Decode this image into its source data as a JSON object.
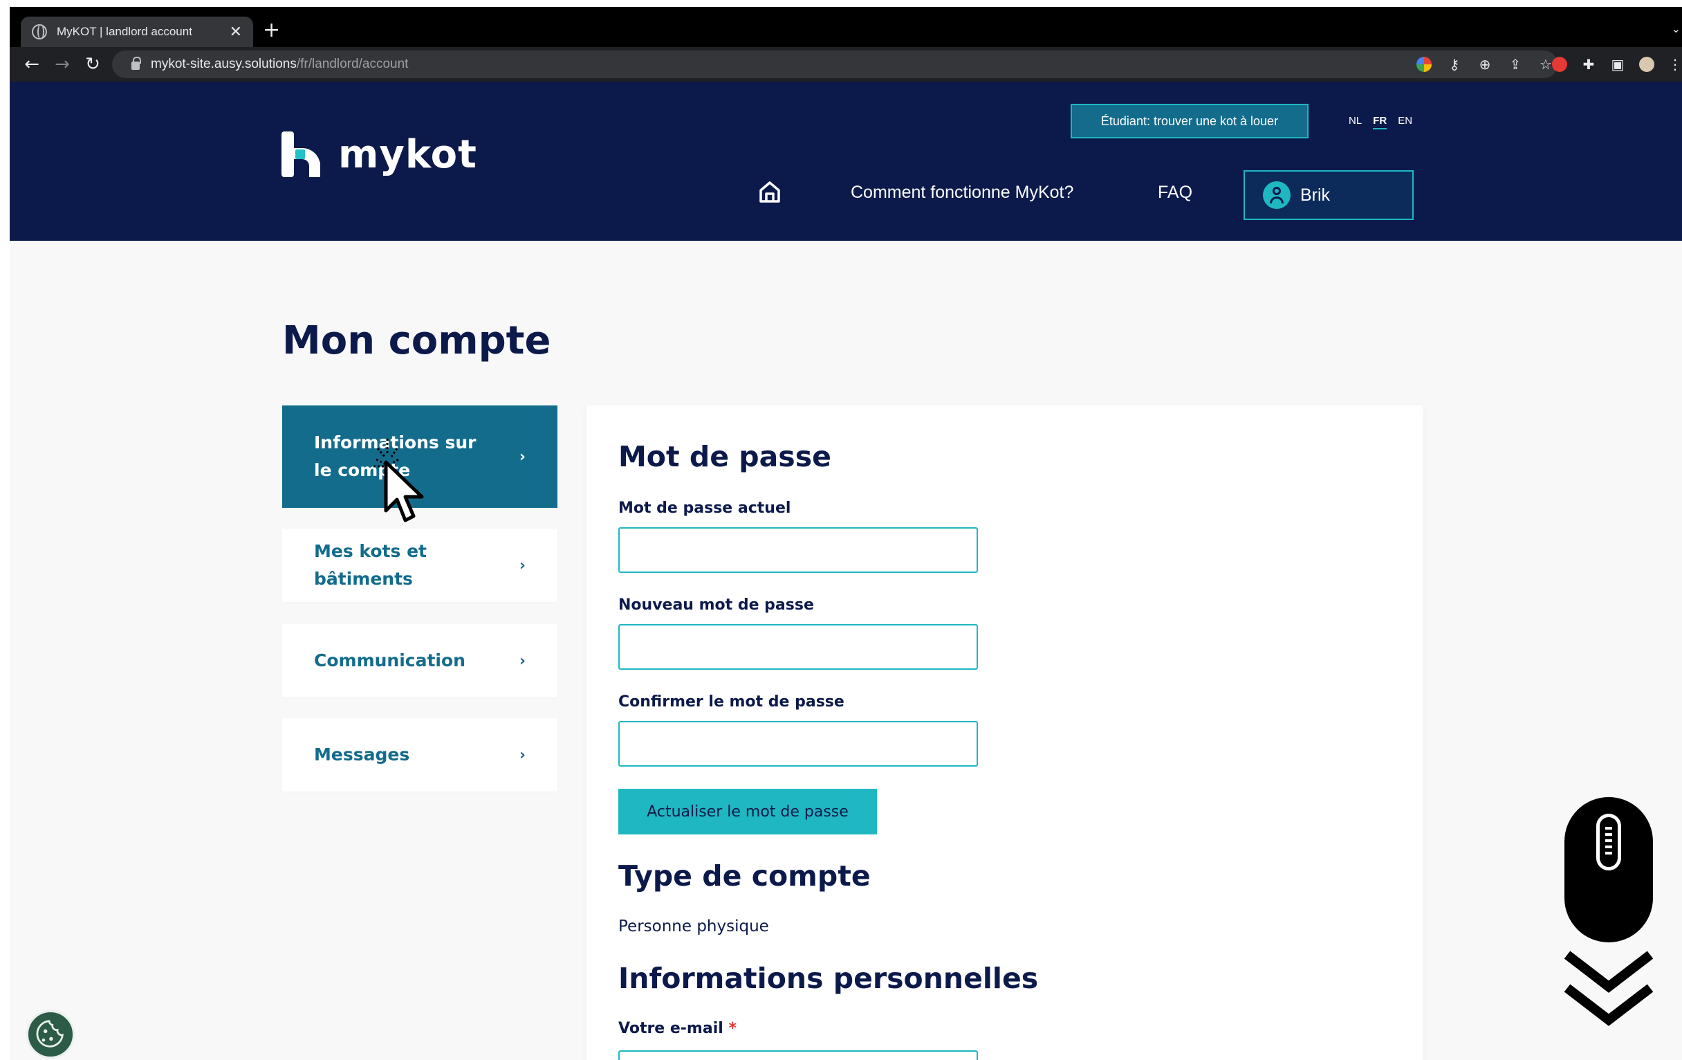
{
  "browser": {
    "tab_title": "MyKOT | landlord account",
    "url_host": "mykot-site.ausy.solutions",
    "url_path": "/fr/landlord/account"
  },
  "header": {
    "logo_text": "mykot",
    "student_button": "Étudiant: trouver une kot à louer",
    "languages": [
      "NL",
      "FR",
      "EN"
    ],
    "active_language": "FR",
    "nav": {
      "how_it_works": "Comment fonctionne MyKot?",
      "faq": "FAQ"
    },
    "user_name": "Brik"
  },
  "page": {
    "title": "Mon compte"
  },
  "sidebar": {
    "items": [
      {
        "label": "Informations sur le compte",
        "active": true
      },
      {
        "label": "Mes kots et bâtiments",
        "active": false
      },
      {
        "label": "Communication",
        "active": false
      },
      {
        "label": "Messages",
        "active": false
      }
    ],
    "chevron": "›"
  },
  "password_section": {
    "title": "Mot de passe",
    "current_label": "Mot de passe actuel",
    "new_label": "Nouveau mot de passe",
    "confirm_label": "Confirmer le mot de passe",
    "current_value": "",
    "new_value": "",
    "confirm_value": "",
    "update_button": "Actualiser le mot de passe"
  },
  "account_type_section": {
    "title": "Type de compte",
    "value": "Personne physique"
  },
  "personal_section": {
    "title": "Informations personnelles",
    "email_label": "Votre e-mail",
    "required_marker": "*"
  },
  "colors": {
    "navy": "#0c1a4b",
    "teal": "#136c8c",
    "cyan": "#1fb7c2",
    "background": "#f8f8f8"
  },
  "icons": [
    "globe-icon",
    "close-icon",
    "plus-icon",
    "back-icon",
    "forward-icon",
    "reload-icon",
    "lock-icon",
    "home-icon",
    "user-icon",
    "chevron-right-icon",
    "cookie-icon",
    "scroll-mouse-icon",
    "double-chevron-down-icon",
    "cursor-icon"
  ]
}
